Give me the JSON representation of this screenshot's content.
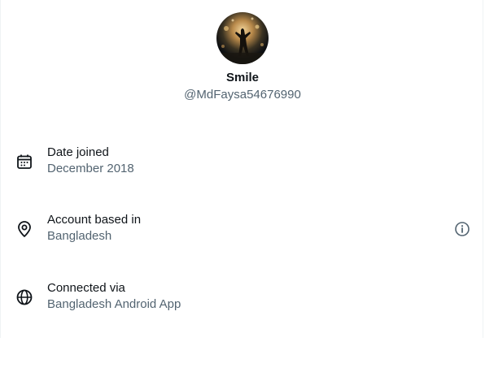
{
  "profile": {
    "display_name": "Smile",
    "handle": "@MdFaysa54676990"
  },
  "rows": [
    {
      "icon": "calendar-icon",
      "label": "Date joined",
      "value": "December 2018"
    },
    {
      "icon": "location-pin-icon",
      "label": "Account based in",
      "value": "Bangladesh",
      "trailing_icon": "info-icon"
    },
    {
      "icon": "globe-icon",
      "label": "Connected via",
      "value": "Bangladesh Android App"
    }
  ],
  "colors": {
    "primary_text": "#0f1419",
    "secondary_text": "#536471",
    "border": "#eff3f4"
  }
}
